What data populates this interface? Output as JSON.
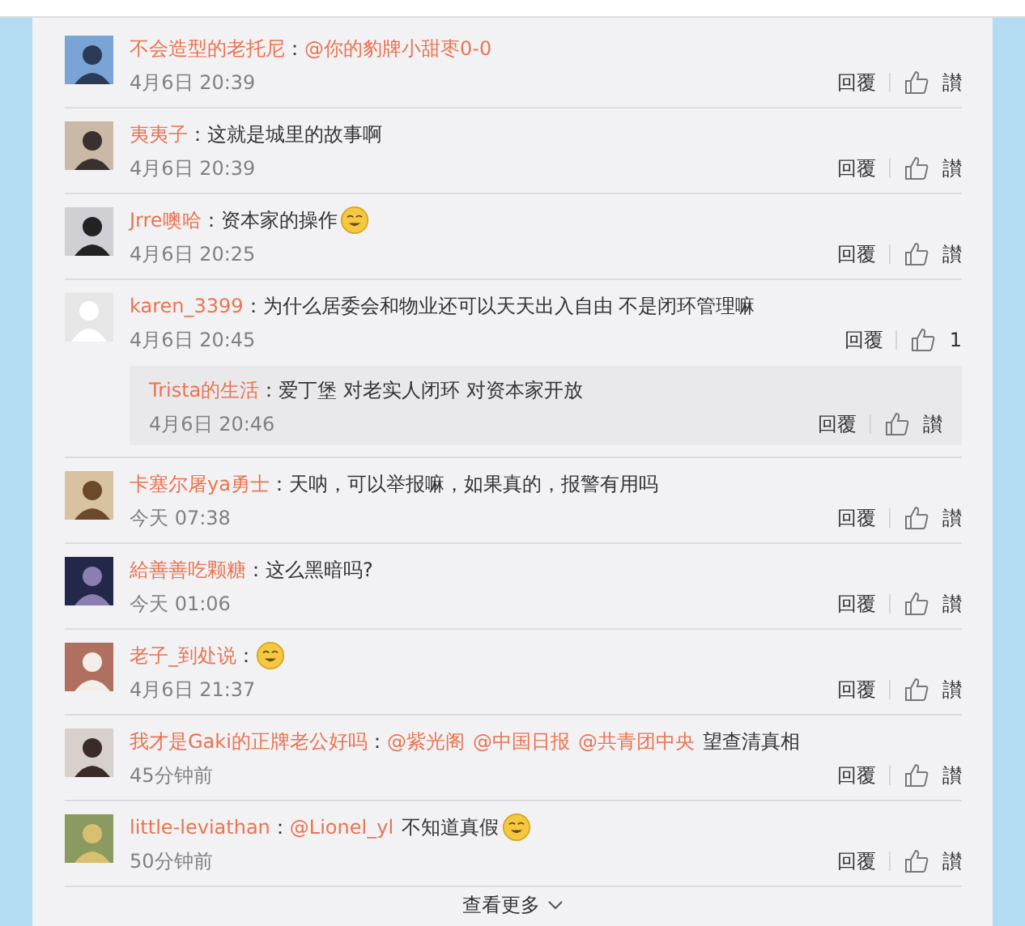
{
  "comments": [
    {
      "avatar": {
        "kind": "picture"
      },
      "name": "不会造型的老托尼",
      "colon": "：",
      "segments": [
        {
          "kind": "mention",
          "text": "@你的豹牌小甜枣0-0"
        }
      ],
      "time": "4月6日 20:39",
      "reply": "回覆",
      "like": "讃"
    },
    {
      "avatar": {
        "kind": "picture"
      },
      "name": "夷夷子",
      "colon": "：",
      "segments": [
        {
          "kind": "text",
          "text": "这就是城里的故事啊"
        }
      ],
      "time": "4月6日 20:39",
      "reply": "回覆",
      "like": "讃"
    },
    {
      "avatar": {
        "kind": "picture"
      },
      "name": "Jrre噢哈",
      "colon": "：",
      "segments": [
        {
          "kind": "text",
          "text": "资本家的操作"
        },
        {
          "kind": "emoji"
        }
      ],
      "time": "4月6日 20:25",
      "reply": "回覆",
      "like": "讃"
    },
    {
      "avatar": {
        "kind": "default"
      },
      "name": "karen_3399",
      "colon": "：",
      "segments": [
        {
          "kind": "text",
          "text": "为什么居委会和物业还可以天天出入自由 不是闭环管理嘛"
        }
      ],
      "time": "4月6日 20:45",
      "reply": "回覆",
      "like": "1",
      "replies": [
        {
          "name": "Trista的生活",
          "colon": "：",
          "segments": [
            {
              "kind": "text",
              "text": "爱丁堡 对老实人闭环 对资本家开放"
            }
          ],
          "time": "4月6日 20:46",
          "reply": "回覆",
          "like": "讃"
        }
      ]
    },
    {
      "avatar": {
        "kind": "picture"
      },
      "name": "卡塞尔屠ya勇士",
      "colon": "：",
      "segments": [
        {
          "kind": "text",
          "text": "天呐，可以举报嘛，如果真的，报警有用吗"
        }
      ],
      "time": "今天 07:38",
      "reply": "回覆",
      "like": "讃"
    },
    {
      "avatar": {
        "kind": "picture"
      },
      "name": "給善善吃颗糖",
      "colon": "：",
      "segments": [
        {
          "kind": "text",
          "text": "这么黑暗吗?"
        }
      ],
      "time": "今天 01:06",
      "reply": "回覆",
      "like": "讃"
    },
    {
      "avatar": {
        "kind": "picture"
      },
      "name": "老子_到处说",
      "colon": "：",
      "segments": [
        {
          "kind": "emoji"
        }
      ],
      "time": "4月6日 21:37",
      "reply": "回覆",
      "like": "讃"
    },
    {
      "avatar": {
        "kind": "picture"
      },
      "name": "我才是Gaki的正牌老公好吗",
      "colon": "：",
      "segments": [
        {
          "kind": "mention",
          "text": "@紫光阁"
        },
        {
          "kind": "mention",
          "text": "@中国日报"
        },
        {
          "kind": "mention",
          "text": "@共青团中央"
        },
        {
          "kind": "text",
          "text": "望查清真相"
        }
      ],
      "time": "45分钟前",
      "reply": "回覆",
      "like": "讃"
    },
    {
      "avatar": {
        "kind": "picture"
      },
      "name": "little-leviathan",
      "colon": "：",
      "segments": [
        {
          "kind": "mention",
          "text": "@Lionel_yl"
        },
        {
          "kind": "text",
          "text": "不知道真假"
        },
        {
          "kind": "emoji"
        }
      ],
      "time": "50分钟前",
      "reply": "回覆",
      "like": "讃"
    }
  ],
  "more": "查看更多"
}
